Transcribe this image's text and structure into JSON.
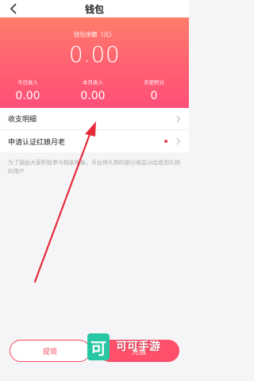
{
  "header": {
    "title": "钱包"
  },
  "balance": {
    "label": "钱包余额（元）",
    "value": "0.00"
  },
  "stats": [
    {
      "label": "今日收入",
      "value": "0.00"
    },
    {
      "label": "本月收入",
      "value": "0.00"
    },
    {
      "label": "天使积分",
      "value": "0"
    }
  ],
  "list": [
    {
      "label": "收支明细"
    },
    {
      "label": "申请认证红娘月老"
    }
  ],
  "note": "为了鼓励大家积极参与相亲相亲，平台将礼物的部分收益分给收到礼物的用户",
  "actions": {
    "withdraw": "提现",
    "recharge": "充值"
  },
  "watermark": {
    "icon_char": "可",
    "text": "可可手游"
  },
  "colors": {
    "hero_top": "#ff8a6a",
    "hero_bottom": "#ff4f79",
    "accent": "#f24a60",
    "watermark": "#28c7a3"
  }
}
